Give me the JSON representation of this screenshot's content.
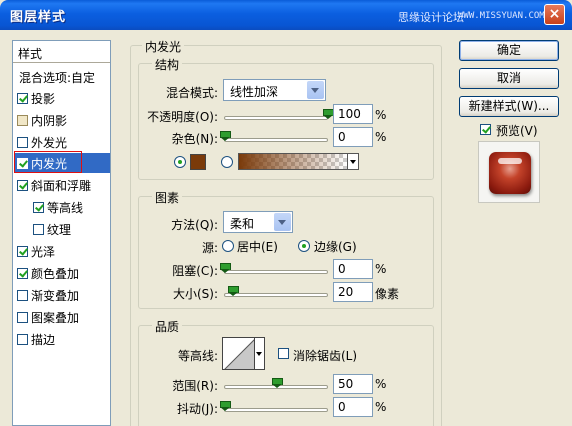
{
  "window": {
    "title": "图层样式",
    "watermark": "思缘设计论坛",
    "watermark_url": "WWW.MISSYUAN.COM",
    "close_glyph": "×"
  },
  "sidebar": {
    "header": "样式",
    "items": [
      {
        "label": "混合选项:自定",
        "checkbox": false
      },
      {
        "label": "投影",
        "checkbox": true,
        "checked": true
      },
      {
        "label": "内阴影",
        "checkbox": true,
        "checked": false,
        "dim": true
      },
      {
        "label": "外发光",
        "checkbox": true,
        "checked": false
      },
      {
        "label": "内发光",
        "checkbox": true,
        "checked": true,
        "selected": true
      },
      {
        "label": "斜面和浮雕",
        "checkbox": true,
        "checked": true
      },
      {
        "label": "等高线",
        "checkbox": true,
        "checked": true,
        "indent": true
      },
      {
        "label": "纹理",
        "checkbox": true,
        "checked": false,
        "indent": true
      },
      {
        "label": "光泽",
        "checkbox": true,
        "checked": true
      },
      {
        "label": "颜色叠加",
        "checkbox": true,
        "checked": true
      },
      {
        "label": "渐变叠加",
        "checkbox": true,
        "checked": false
      },
      {
        "label": "图案叠加",
        "checkbox": true,
        "checked": false
      },
      {
        "label": "描边",
        "checkbox": true,
        "checked": false
      }
    ]
  },
  "inner_glow": {
    "title": "内发光",
    "structure": {
      "title": "结构",
      "blend_mode_label": "混合模式:",
      "blend_mode_value": "线性加深",
      "opacity_label": "不透明度(O):",
      "opacity_value": "100",
      "opacity_level": 1.0,
      "noise_label": "杂色(N):",
      "noise_value": "0",
      "noise_level": 0.0,
      "percent": "%",
      "glow_color": "#7a3a0a"
    },
    "elements": {
      "title": "图素",
      "technique_label": "方法(Q):",
      "technique_value": "柔和",
      "source_label": "源:",
      "source_center": "居中(E)",
      "source_edge": "边缘(G)",
      "source_selected": "edge",
      "choke_label": "阻塞(C):",
      "choke_value": "0",
      "choke_level": 0.0,
      "size_label": "大小(S):",
      "size_value": "20",
      "size_unit": "像素",
      "size_level": 0.08,
      "percent": "%"
    },
    "quality": {
      "title": "品质",
      "contour_label": "等高线:",
      "antialias_label": "消除锯齿(L)",
      "antialias_checked": false,
      "range_label": "范围(R):",
      "range_value": "50",
      "range_level": 0.5,
      "jitter_label": "抖动(J):",
      "jitter_value": "0",
      "jitter_level": 0.0,
      "percent": "%"
    }
  },
  "actions": {
    "ok": "确定",
    "cancel": "取消",
    "new_style": "新建样式(W)...",
    "preview_label": "预览(V)",
    "preview_checked": true
  }
}
